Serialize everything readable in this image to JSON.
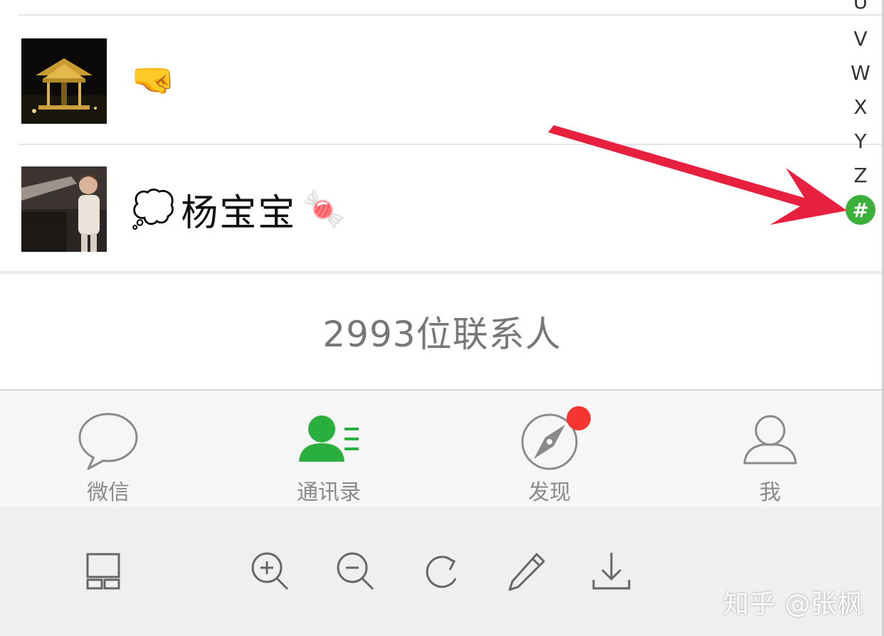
{
  "contacts": [
    {
      "emoji_before": "🤜",
      "name": "",
      "emoji_after": "",
      "avatar": "night-pavilion-photo"
    },
    {
      "emoji_before": "💭",
      "name": "杨宝宝",
      "emoji_after": "🍬",
      "avatar": "child-photo"
    }
  ],
  "contact_count": "2993位联系人",
  "index_bar": {
    "letters": [
      "U",
      "V",
      "W",
      "X",
      "Y",
      "Z"
    ],
    "active": "#"
  },
  "tabs": [
    {
      "label": "微信",
      "icon": "chat-bubble-icon",
      "active": false
    },
    {
      "label": "通讯录",
      "icon": "contacts-icon",
      "active": true
    },
    {
      "label": "发现",
      "icon": "compass-icon",
      "active": false,
      "badge": true
    },
    {
      "label": "我",
      "icon": "person-icon",
      "active": false
    }
  ],
  "toolbar": [
    "layout-icon",
    "zoom-in-icon",
    "zoom-out-icon",
    "rotate-icon",
    "edit-icon",
    "download-icon"
  ],
  "watermark": "知乎 @张枫",
  "colors": {
    "accent": "#2aae3e",
    "arrow": "#e8203f",
    "badge": "#f43530",
    "index_active": "#3ab03a"
  }
}
